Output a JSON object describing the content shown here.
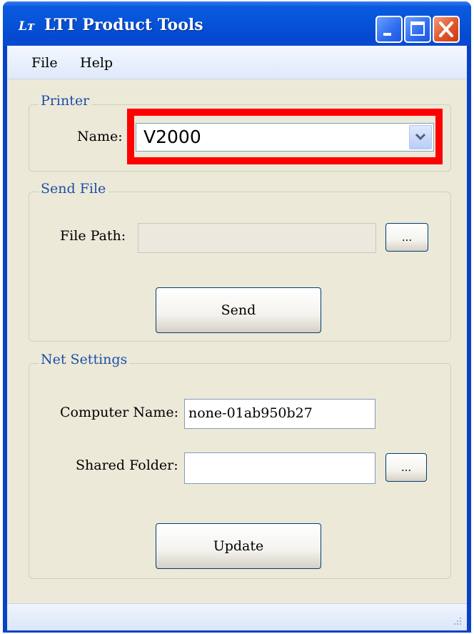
{
  "window": {
    "title": "LTT Product Tools",
    "icon_text": "Lᴛ"
  },
  "menu": {
    "items": [
      "File",
      "Help"
    ]
  },
  "printer": {
    "legend": "Printer",
    "name_label": "Name:",
    "name_value": "V2000"
  },
  "send_file": {
    "legend": "Send File",
    "path_label": "File Path:",
    "path_value": "",
    "browse_label": "...",
    "send_label": "Send"
  },
  "net_settings": {
    "legend": "Net Settings",
    "computer_label": "Computer Name:",
    "computer_value": "none-01ab950b27",
    "shared_label": "Shared Folder:",
    "shared_value": "",
    "browse_label": "...",
    "update_label": "Update"
  },
  "colors": {
    "title_bar": "#0653d8",
    "highlight": "#ff0000",
    "legend_text": "#1d4fa6"
  }
}
